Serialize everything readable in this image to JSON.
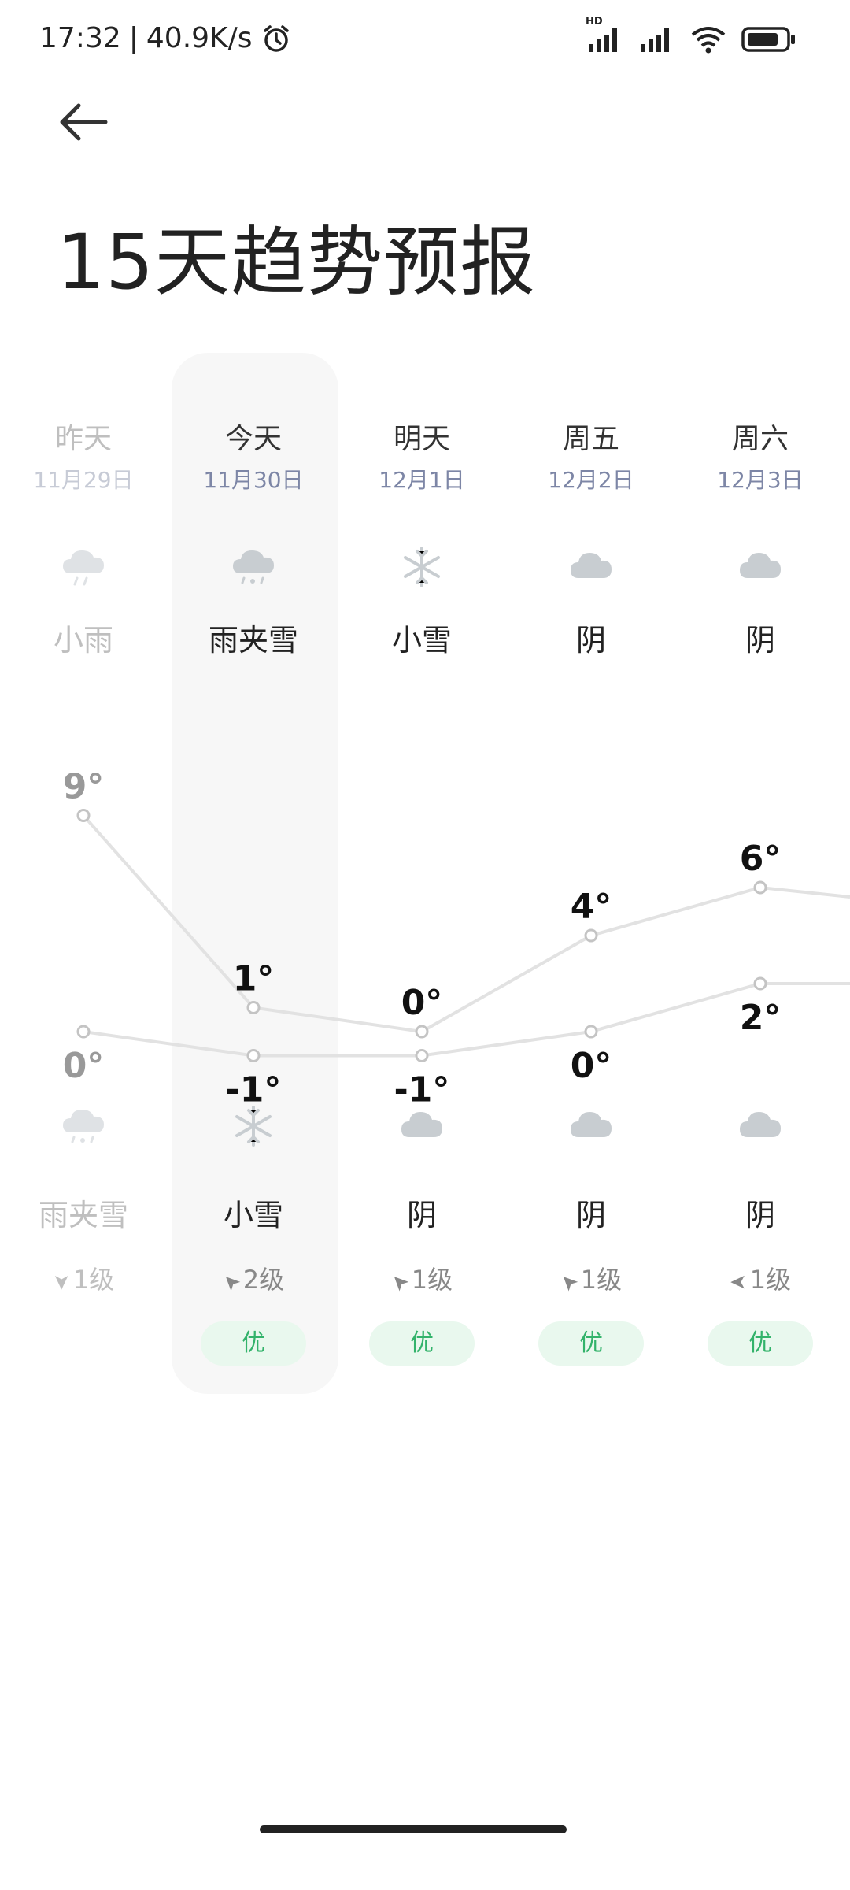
{
  "status_bar": {
    "time": "17:32",
    "separator": "|",
    "speed": "40.9K/s",
    "network": "HD"
  },
  "header": {
    "title": "15天趋势预报"
  },
  "days": [
    {
      "day": "昨天",
      "date": "11月29日",
      "icon_top": "rain-icon",
      "cond_top": "小雨",
      "high": "9°",
      "low": "0°",
      "icon_bot": "sleet-icon",
      "cond_bot": "雨夹雪",
      "wind_dir": "south",
      "wind": "1级",
      "aqi": ""
    },
    {
      "day": "今天",
      "date": "11月30日",
      "icon_top": "sleet-icon",
      "cond_top": "雨夹雪",
      "high": "1°",
      "low": "-1°",
      "icon_bot": "snowflake-icon",
      "cond_bot": "小雪",
      "wind_dir": "northwest",
      "wind": "2级",
      "aqi": "优"
    },
    {
      "day": "明天",
      "date": "12月1日",
      "icon_top": "snowflake-icon",
      "cond_top": "小雪",
      "high": "0°",
      "low": "-1°",
      "icon_bot": "cloud-icon",
      "cond_bot": "阴",
      "wind_dir": "northwest",
      "wind": "1级",
      "aqi": "优"
    },
    {
      "day": "周五",
      "date": "12月2日",
      "icon_top": "cloud-icon",
      "cond_top": "阴",
      "high": "4°",
      "low": "0°",
      "icon_bot": "cloud-icon",
      "cond_bot": "阴",
      "wind_dir": "northwest",
      "wind": "1级",
      "aqi": "优"
    },
    {
      "day": "周六",
      "date": "12月3日",
      "icon_top": "cloud-icon",
      "cond_top": "阴",
      "high": "6°",
      "low": "2°",
      "icon_bot": "cloud-icon",
      "cond_bot": "阴",
      "wind_dir": "west",
      "wind": "1级",
      "aqi": "优"
    }
  ],
  "temperatures": {
    "high": [
      9,
      1,
      0,
      4,
      6
    ],
    "low": [
      0,
      -1,
      -1,
      0,
      2
    ]
  },
  "colors": {
    "accent_green": "#33b36b",
    "aqi_bg": "#e9f8ee",
    "today_bg": "#f7f7f7",
    "date_color": "#7d86a6"
  }
}
